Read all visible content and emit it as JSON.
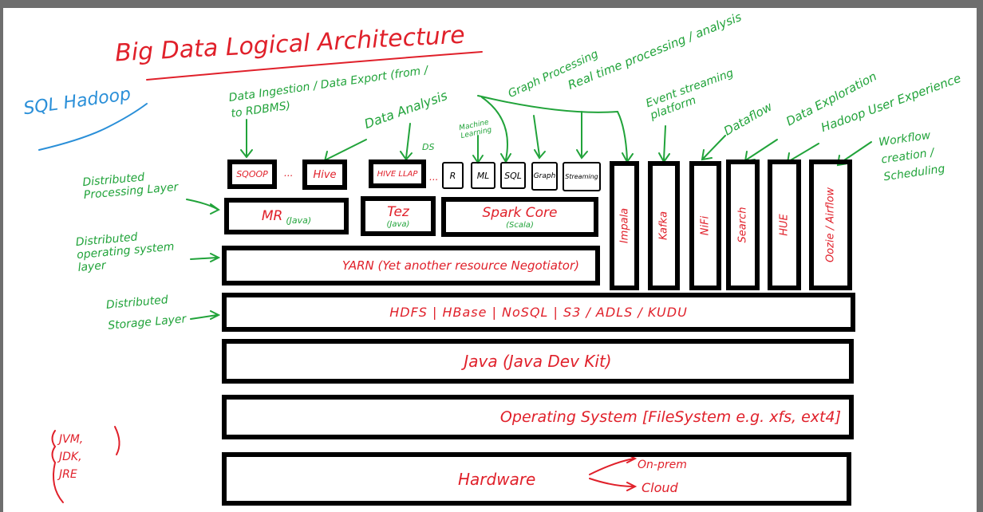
{
  "title": "Big Data Logical Architecture",
  "side_note": "SQL Hadoop",
  "top_components": [
    "SQOOP",
    "Hive",
    "HIVE LLAP",
    "R",
    "ML",
    "SQL",
    "Graph",
    "Streaming"
  ],
  "ellipsis": "...",
  "processing": [
    {
      "name": "MR",
      "lang": "(Java)"
    },
    {
      "name": "Tez",
      "lang": "(Java)"
    },
    {
      "name": "Spark Core",
      "lang": "(Scala)"
    }
  ],
  "yarn": "YARN (Yet another resource Negotiator)",
  "storage": "HDFS | HBase | NoSQL | S3 / ADLS / KUDU",
  "java": "Java (Java Dev Kit)",
  "os": "Operating System [FileSystem e.g. xfs, ext4]",
  "hardware": "Hardware",
  "hardware_targets": [
    "On-prem",
    "Cloud"
  ],
  "vertical_tools": [
    "Impala",
    "Kafka",
    "NiFi",
    "Search",
    "HUE",
    "Oozie / Airflow"
  ],
  "annotations": {
    "ingestion": "Data Ingestion / Data Export (from / to RDBMS)",
    "analysis": "Data Analysis",
    "ds": "DS",
    "ml": "Machine Learning",
    "graph": "Graph Processing",
    "realtime": "Real time processing / analysis",
    "event": "Event streaming platform",
    "dataflow": "Dataflow",
    "exploration": "Data Exploration",
    "hue": "Hadoop User Experience",
    "workflow": "Workflow creation / Scheduling"
  },
  "layers": {
    "processing": "Distributed Processing Layer",
    "os": "Distributed operating system layer",
    "storage": "Distributed Storage Layer"
  },
  "java_parts": [
    "JVM,",
    "JDK,",
    "JRE"
  ],
  "colors": {
    "red": "#e0202a",
    "green": "#21a33a",
    "blue": "#2a8fd8"
  }
}
